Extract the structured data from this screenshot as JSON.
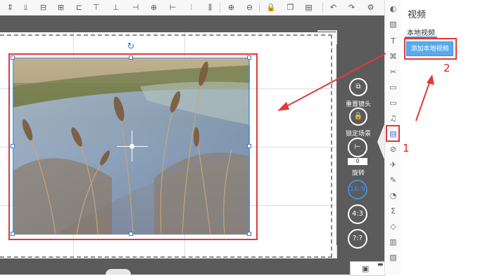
{
  "toolbar": {
    "icons": [
      "align-distribute-icon",
      "align-vertical-center-icon",
      "align-horizontal-center-icon",
      "align-grid-icon",
      "align-left-edge-icon",
      "align-top-icon",
      "align-bottom-icon",
      "align-center-icon",
      "align-middle-icon",
      "align-baseline-icon",
      "align-spacing-icon",
      "zoom-in-icon",
      "zoom-out-icon",
      "lock-icon",
      "copy-icon",
      "paste-icon",
      "delete-icon",
      "undo-icon",
      "redo-icon",
      "settings-icon"
    ]
  },
  "camera_controls": {
    "reset_label": "重置镜头",
    "lock_label": "锁定场景",
    "rotate_label": "旋转",
    "rotate_value": "0",
    "ratio_169": "16:9",
    "ratio_43": "4:3",
    "ratio_custom": "?:?"
  },
  "side_icons": [
    "background-icon",
    "image-icon",
    "text-icon",
    "shape-icon",
    "magic-icon",
    "comment-icon",
    "folder-icon",
    "music-icon",
    "video-icon",
    "compass-icon",
    "plane-icon",
    "pen-icon",
    "chart-icon",
    "sigma-icon",
    "drop-icon",
    "layers-icon",
    "image-small-icon"
  ],
  "right_panel": {
    "title": "视频",
    "local_tab": "本地视频",
    "add_button": "添加本地视频"
  },
  "annotations": {
    "step1": "1",
    "step2": "2"
  },
  "colors": {
    "annotation_red": "#e03a3a",
    "button_blue": "#5aa9ee",
    "canvas_gray": "#5b5b5b"
  }
}
